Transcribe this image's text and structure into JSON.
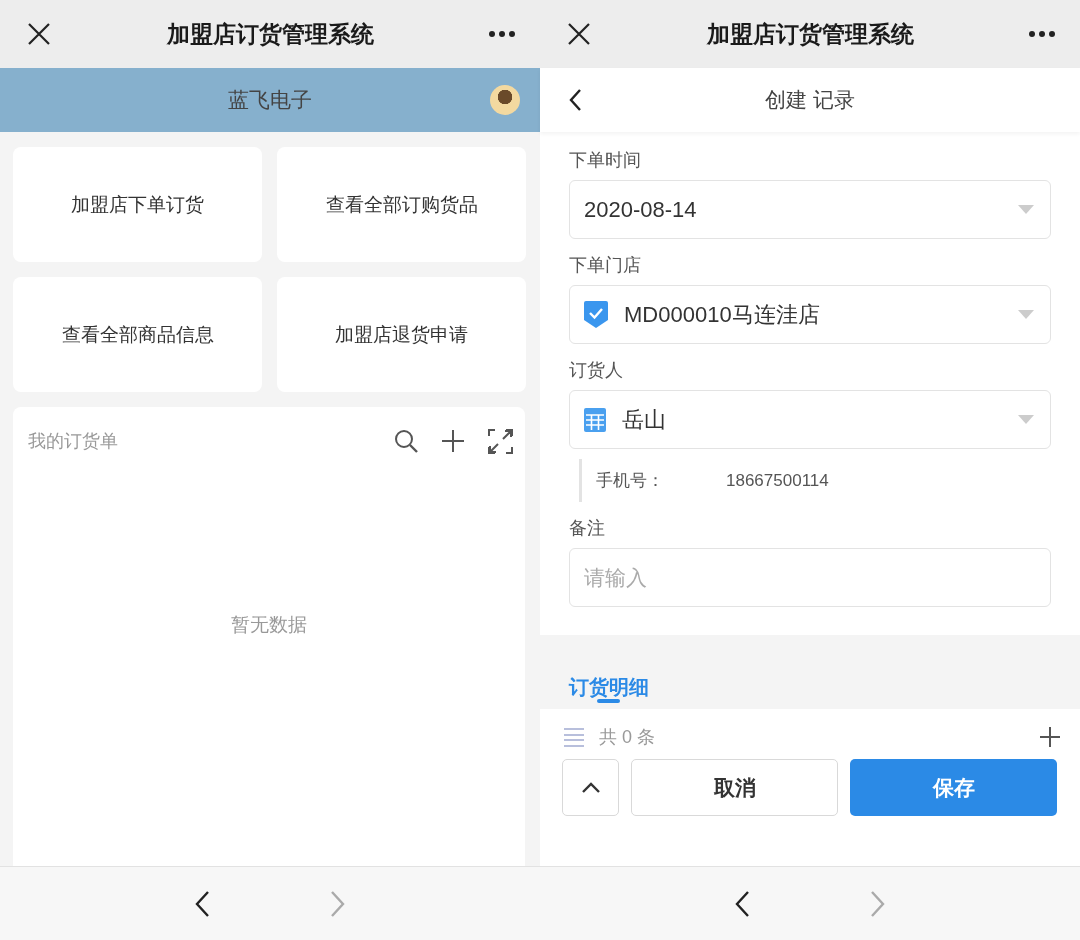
{
  "left": {
    "window": {
      "title": "加盟店订货管理系统"
    },
    "header": {
      "title": "蓝飞电子"
    },
    "tiles": [
      {
        "label": "加盟店下单订货"
      },
      {
        "label": "查看全部订购货品"
      },
      {
        "label": "查看全部商品信息"
      },
      {
        "label": "加盟店退货申请"
      }
    ],
    "list": {
      "title": "我的订货单",
      "empty_text": "暂无数据"
    },
    "nav": {
      "back_disabled": false,
      "forward_disabled": true
    }
  },
  "right": {
    "window": {
      "title": "加盟店订货管理系统"
    },
    "header": {
      "title": "创建 记录"
    },
    "fields": [
      {
        "label": "下单时间",
        "kind": "date",
        "value": "2020-08-14"
      },
      {
        "label": "下单门店",
        "kind": "record",
        "value": "MD000010马连洼店"
      },
      {
        "label": "订货人",
        "kind": "member",
        "value": "岳山",
        "sub": {
          "label": "手机号：",
          "value": "18667500114"
        }
      },
      {
        "label": "备注",
        "kind": "text",
        "placeholder": "请输入"
      }
    ],
    "detail_tabs": [
      {
        "label": "订货明细",
        "selected": true
      }
    ],
    "count": "共 0 条",
    "buttons": {
      "cancel": "取消",
      "save": "保存"
    },
    "nav": {
      "back_disabled": false,
      "forward_disabled": true
    }
  }
}
